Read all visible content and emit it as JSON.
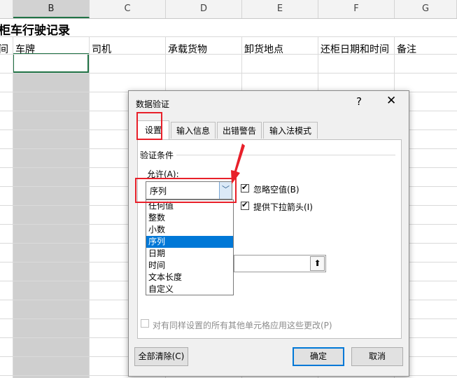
{
  "sheet": {
    "columns": [
      "B",
      "C",
      "D",
      "E",
      "F",
      "G"
    ],
    "selected_column": "B",
    "title": "柜车行驶记录",
    "headers": [
      "间",
      "车牌",
      "司机",
      "承载货物",
      "卸货地点",
      "还柜日期和时间",
      "备注"
    ]
  },
  "dialog": {
    "title": "数据验证",
    "help": "?",
    "close": "✕",
    "tabs": [
      "设置",
      "输入信息",
      "出错警告",
      "输入法模式"
    ],
    "active_tab": "设置",
    "section_title": "验证条件",
    "allow_label": "允许(A):",
    "allow_value": "序列",
    "dropdown_arrow": "﹀",
    "options": [
      "任何值",
      "整数",
      "小数",
      "序列",
      "日期",
      "时间",
      "文本长度",
      "自定义"
    ],
    "selected_option": "序列",
    "ignore_blank_label": "忽略空值(B)",
    "ignore_blank_checked": true,
    "dropdown_arrow_label": "提供下拉箭头(I)",
    "dropdown_arrow_checked": true,
    "apply_all_label": "对有同样设置的所有其他单元格应用这些更改(P)",
    "apply_all_checked": false,
    "source_button_icon": "collapse-icon",
    "source_button_glyph": "⬆",
    "clear_all_label": "全部清除(C)",
    "ok_label": "确定",
    "cancel_label": "取消",
    "highlight_color": "#e8202a",
    "check_glyph": "✔"
  }
}
